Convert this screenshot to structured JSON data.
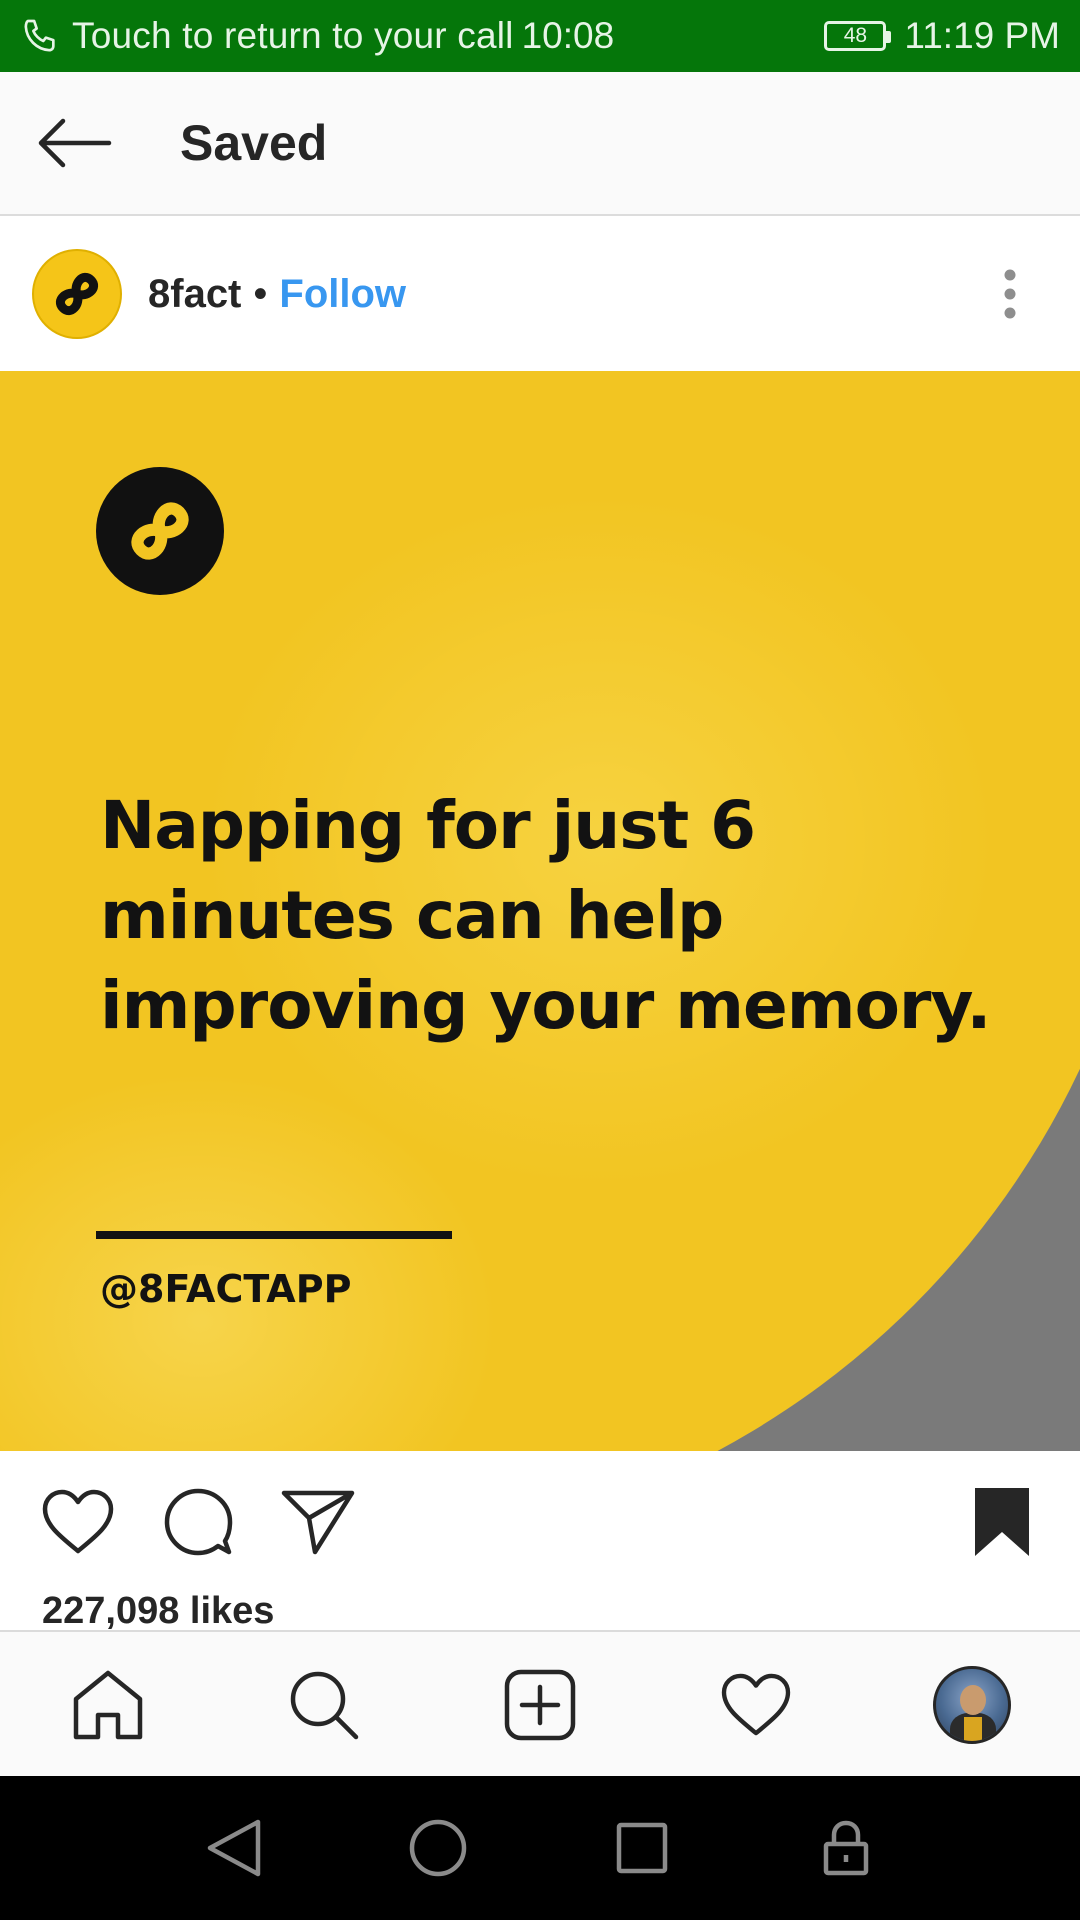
{
  "status_bar": {
    "call_text": "Touch to return to your call",
    "call_timer": "10:08",
    "battery": "48",
    "clock": "11:19 PM",
    "bg_color": "#05760a"
  },
  "header": {
    "title": "Saved"
  },
  "post": {
    "username": "8fact",
    "separator": "•",
    "follow_label": "Follow",
    "accent_color": "#3897f0",
    "image": {
      "headline": "Napping for just 6 minutes can help improving your memory.",
      "handle": "@8FACTAPP",
      "bg_color": "#f2c522"
    },
    "likes": "227,098 likes",
    "saved": true
  },
  "icons": {
    "back": "back-arrow-icon",
    "more": "more-vertical-icon",
    "like": "heart-icon",
    "comment": "comment-icon",
    "share": "send-icon",
    "save": "bookmark-filled-icon",
    "nav_home": "home-icon",
    "nav_search": "search-icon",
    "nav_add": "add-post-icon",
    "nav_activity": "heart-icon",
    "nav_profile": "profile-avatar"
  }
}
